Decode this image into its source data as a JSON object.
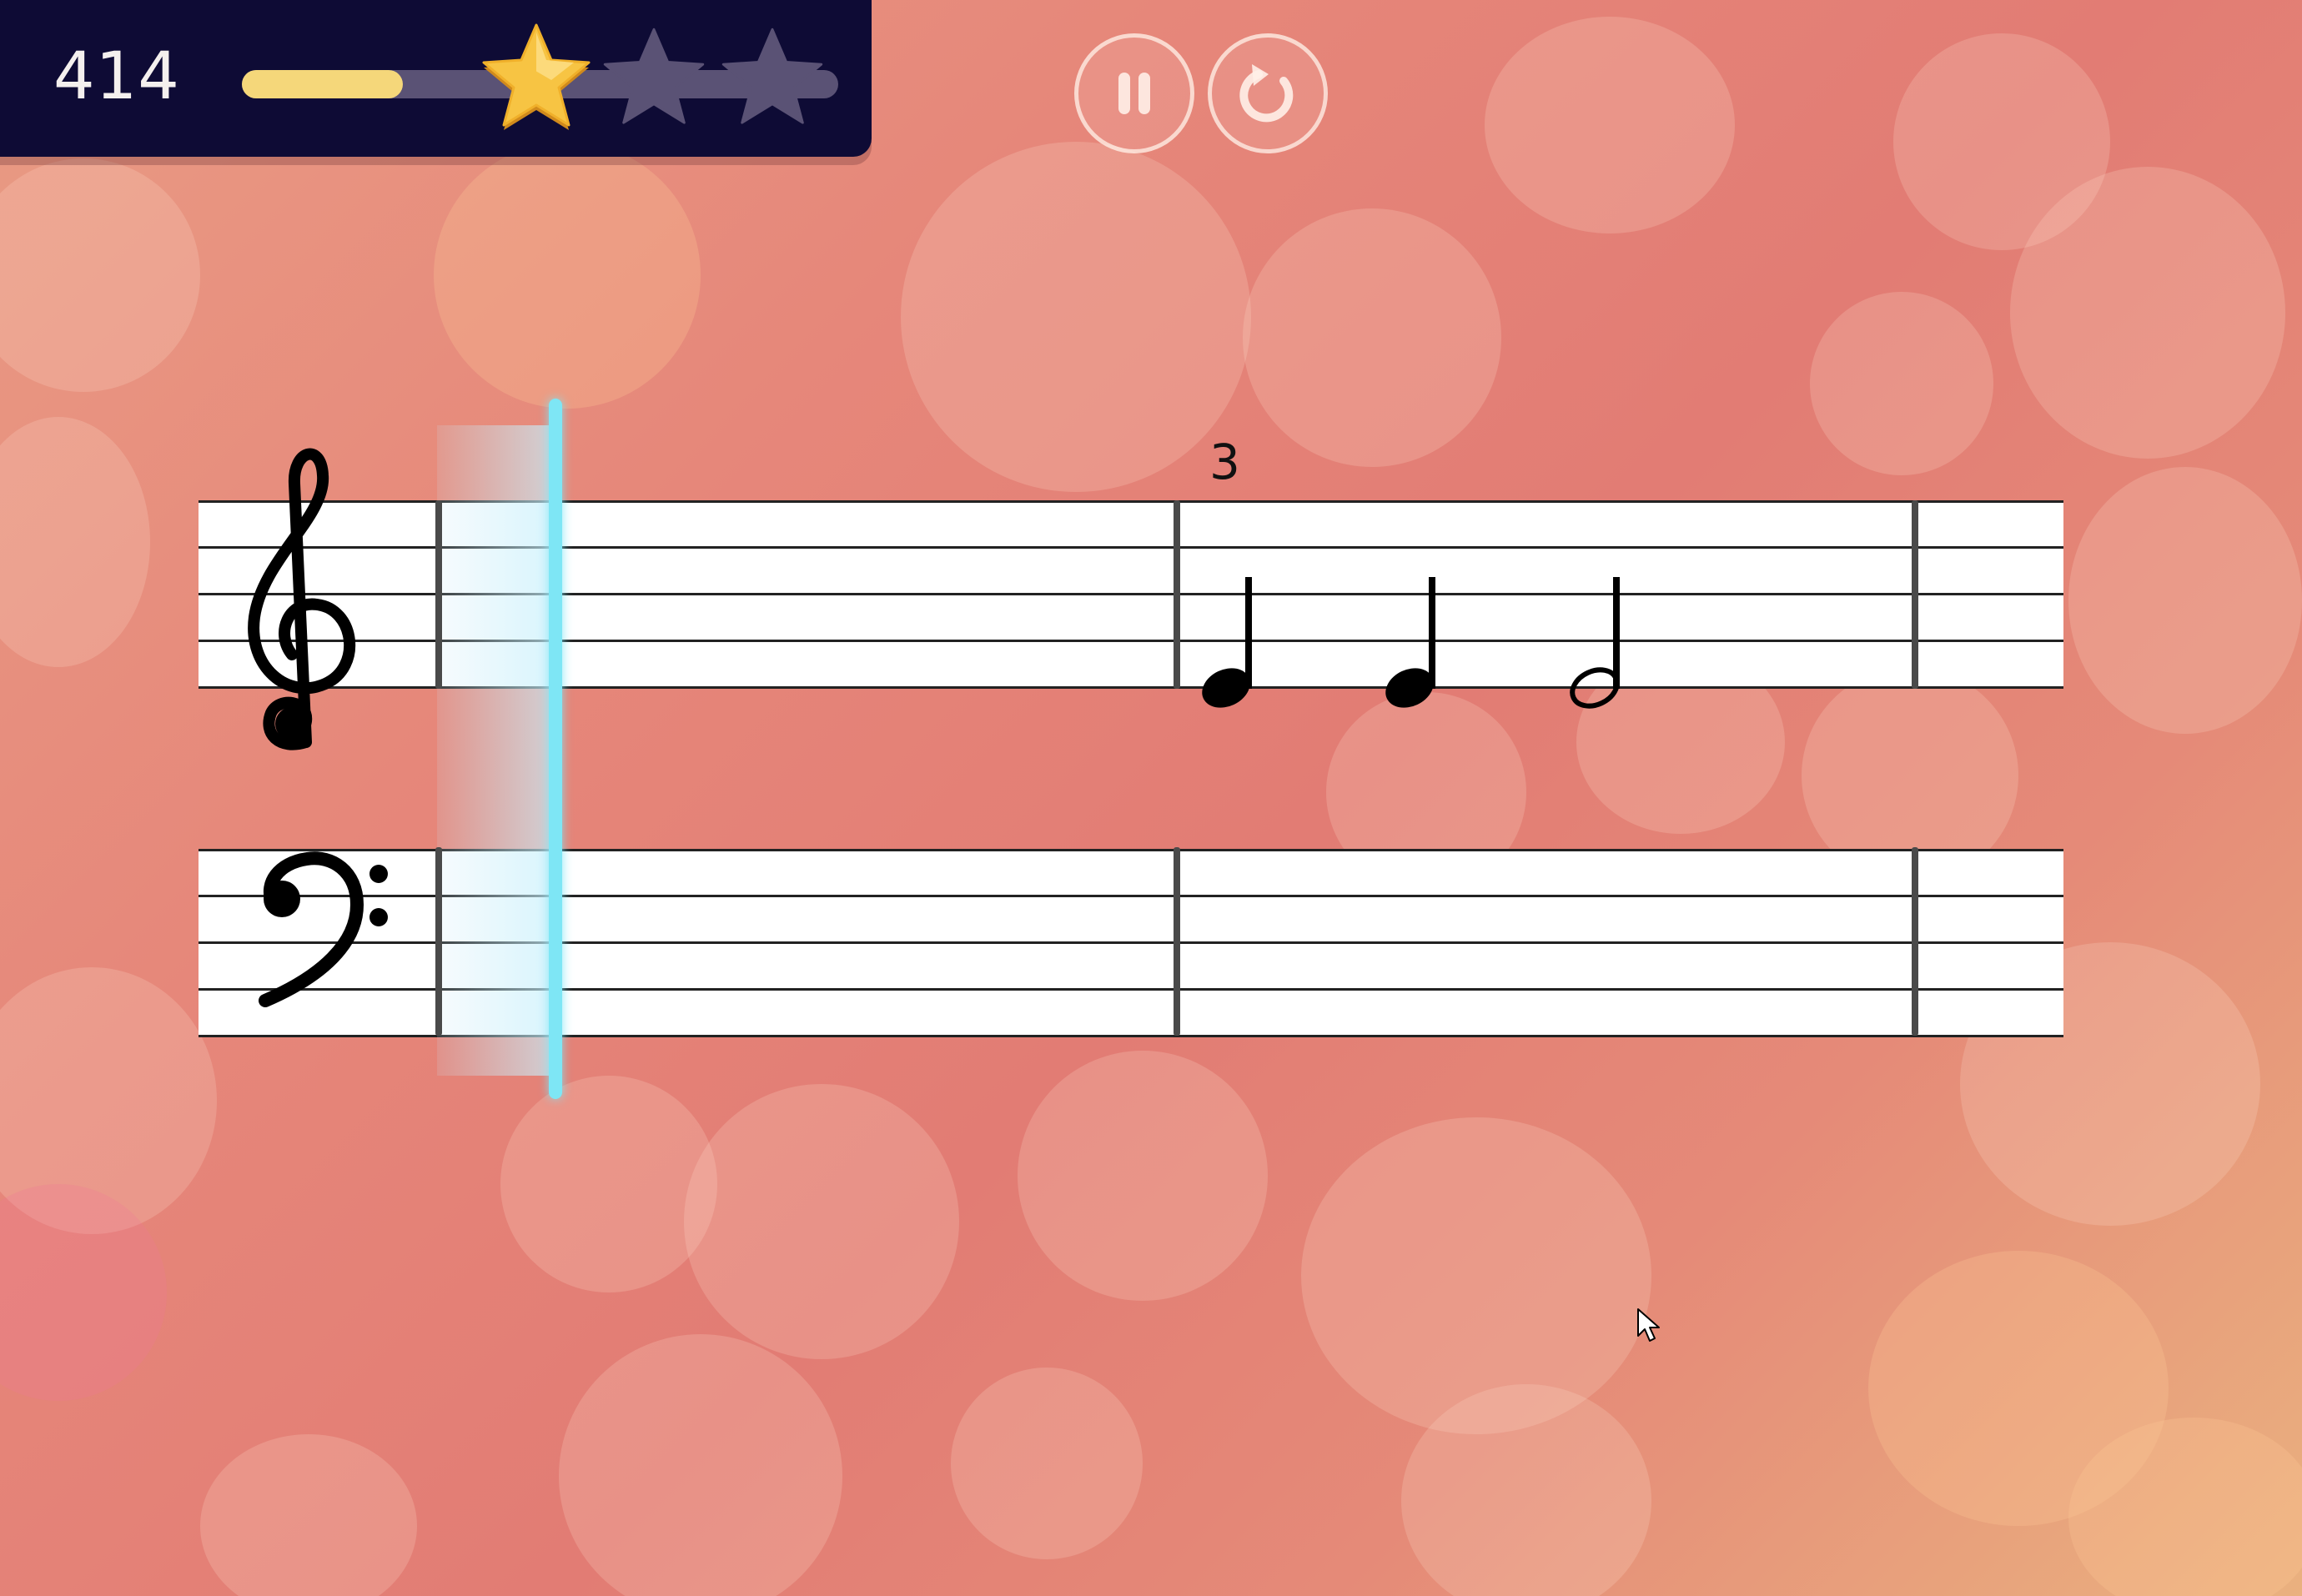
{
  "hud": {
    "score": "414",
    "progress_fraction": 0.27,
    "stars_earned": 1,
    "stars_total": 3
  },
  "controls": {
    "pause_icon": "pause-icon",
    "restart_icon": "restart-icon"
  },
  "score_sheet": {
    "measure_number": "3",
    "clefs": [
      "treble-clef-icon",
      "bass-clef-icon"
    ],
    "notes": [
      {
        "staff": "treble",
        "duration": "quarter",
        "pitch": "E4"
      },
      {
        "staff": "treble",
        "duration": "quarter",
        "pitch": "E4"
      },
      {
        "staff": "treble",
        "duration": "half",
        "pitch": "E4"
      }
    ]
  },
  "colors": {
    "hud_bg": "#0e0b35",
    "progress_fill": "#f5d77a",
    "progress_track": "#5a5275",
    "star_earned": "#f7c443",
    "star_empty": "#5a5275",
    "playhead": "#7ee6f5"
  }
}
